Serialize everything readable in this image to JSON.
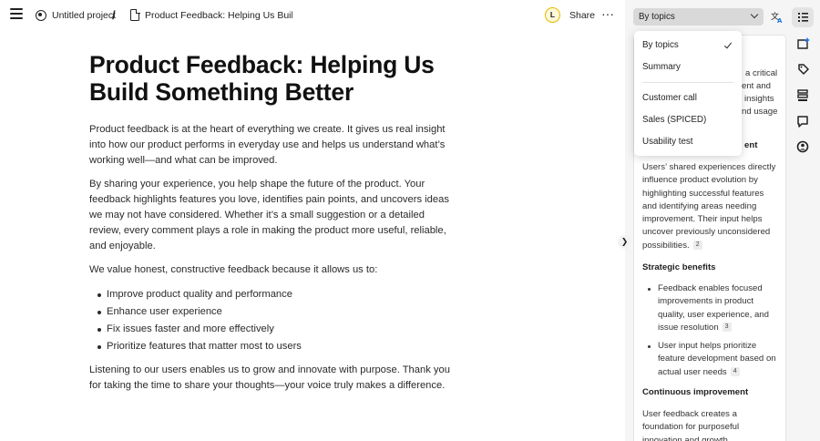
{
  "header": {
    "project_name": "Untitled project",
    "breadcrumb_separator": "/",
    "document_name": "Product Feedback: Helping Us Build S...",
    "avatar_initial": "L",
    "share_label": "Share",
    "more_label": "···"
  },
  "document": {
    "title": "Product Feedback: Helping Us Build Something Better",
    "paragraphs": [
      "Product feedback is at the heart of everything we create. It gives us real insight into how our product performs in everyday use and helps us understand what’s working well—and what can be improved.",
      "By sharing your experience, you help shape the future of the product. Your feedback highlights features you love, identifies pain points, and uncovers ideas we may not have considered. Whether it’s a small suggestion or a detailed review, every comment plays a role in making the product more useful, reliable, and enjoyable.",
      "We value honest, constructive feedback because it allows us to:"
    ],
    "bullets": [
      "Improve product quality and performance",
      "Enhance user experience",
      "Fix issues faster and more effectively",
      "Prioritize features that matter most to users"
    ],
    "closing": "Listening to our users enables us to grow and innovate with purpose. Thank you for taking the time to share your thoughts—your voice truly makes a difference."
  },
  "panel": {
    "select_value": "By topics",
    "hidden_fragments": [
      "a critical",
      "ent and",
      "insights",
      "nd usage",
      "ent"
    ],
    "user_impact_text": "Users’ shared experiences directly influence product evolution by highlighting successful features and identifying areas needing improvement. Their input helps uncover previously unconsidered possibilities.",
    "user_impact_cite": "2",
    "strategic_heading": "Strategic benefits",
    "strategic_bullets": [
      {
        "text": "Feedback enables focused improvements in product quality, user experience, and issue resolution",
        "cite": "3"
      },
      {
        "text": "User input helps prioritize feature development based on actual user needs",
        "cite": "4"
      }
    ],
    "continuous_heading": "Continuous improvement",
    "continuous_text": "User feedback creates a foundation for purposeful innovation and growth, emphasizing the significance"
  },
  "dropdown": {
    "options": [
      "By topics",
      "Summary",
      "Customer call",
      "Sales (SPICED)",
      "Usability test"
    ],
    "selected": "By topics"
  },
  "colors": {
    "avatar_ring": "#e6b800",
    "select_bg": "#d9d9d9",
    "panel_bg": "#f5f5f5"
  }
}
